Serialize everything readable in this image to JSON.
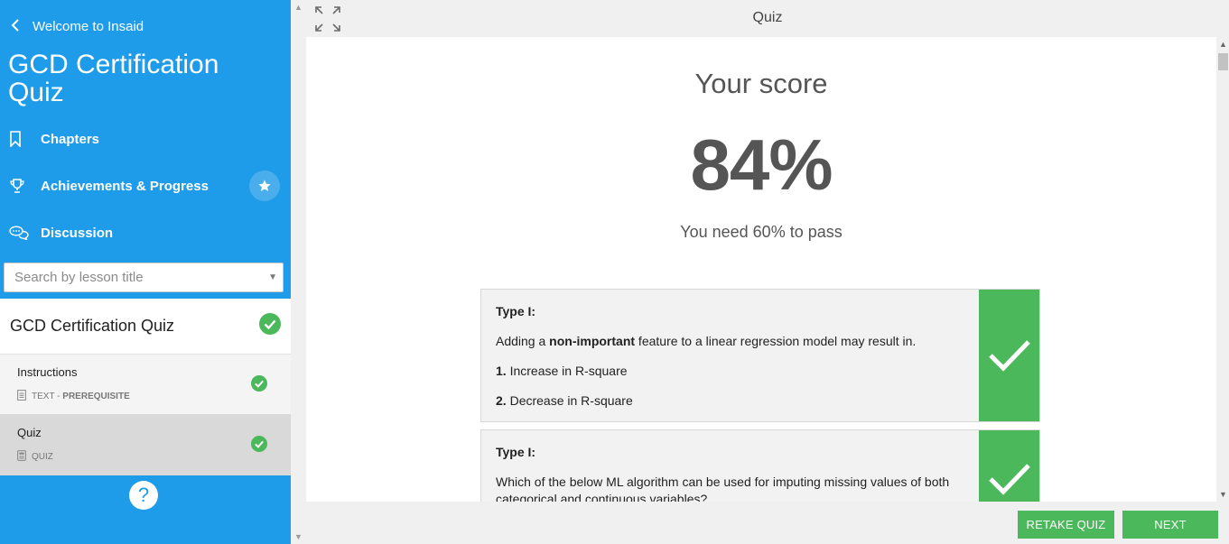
{
  "sidebar": {
    "back_label": "Welcome to Insaid",
    "course_title": "GCD Certification Quiz",
    "nav": [
      {
        "label": "Chapters",
        "icon": "bookmark-icon"
      },
      {
        "label": "Achievements & Progress",
        "icon": "trophy-icon"
      },
      {
        "label": "Discussion",
        "icon": "chat-icon"
      }
    ],
    "search_placeholder": "Search by lesson title",
    "section": {
      "title": "GCD Certification Quiz",
      "status_icon": "check-circle-icon"
    },
    "lessons": [
      {
        "title": "Instructions",
        "type": "TEXT",
        "separator": " - ",
        "tag": "PREREQUISITE",
        "completed": true
      },
      {
        "title": "Quiz",
        "type": "QUIZ",
        "completed": true,
        "active": true
      }
    ],
    "help_label": "?"
  },
  "header": {
    "title": "Quiz"
  },
  "result": {
    "score_label": "Your score",
    "score_value": "84%",
    "pass_label": "You need 60% to pass"
  },
  "questions": [
    {
      "type": "Type I:",
      "text_before": "Adding a ",
      "text_bold": "non-important",
      "text_after": " feature to a linear regression model may result in.",
      "options": [
        {
          "num": "1.",
          "text": " Increase in R-square"
        },
        {
          "num": "2.",
          "text": " Decrease in R-square"
        }
      ],
      "correct": true
    },
    {
      "type": "Type I:",
      "text": "Which of the below ML algorithm can be used for imputing missing values of both categorical and continuous variables?",
      "correct": true
    }
  ],
  "footer": {
    "retake_label": "RETAKE QUIZ",
    "next_label": "NEXT"
  },
  "colors": {
    "sidebar_bg": "#1e9be9",
    "accent_green": "#4cb85c",
    "text_dark": "#555555"
  }
}
